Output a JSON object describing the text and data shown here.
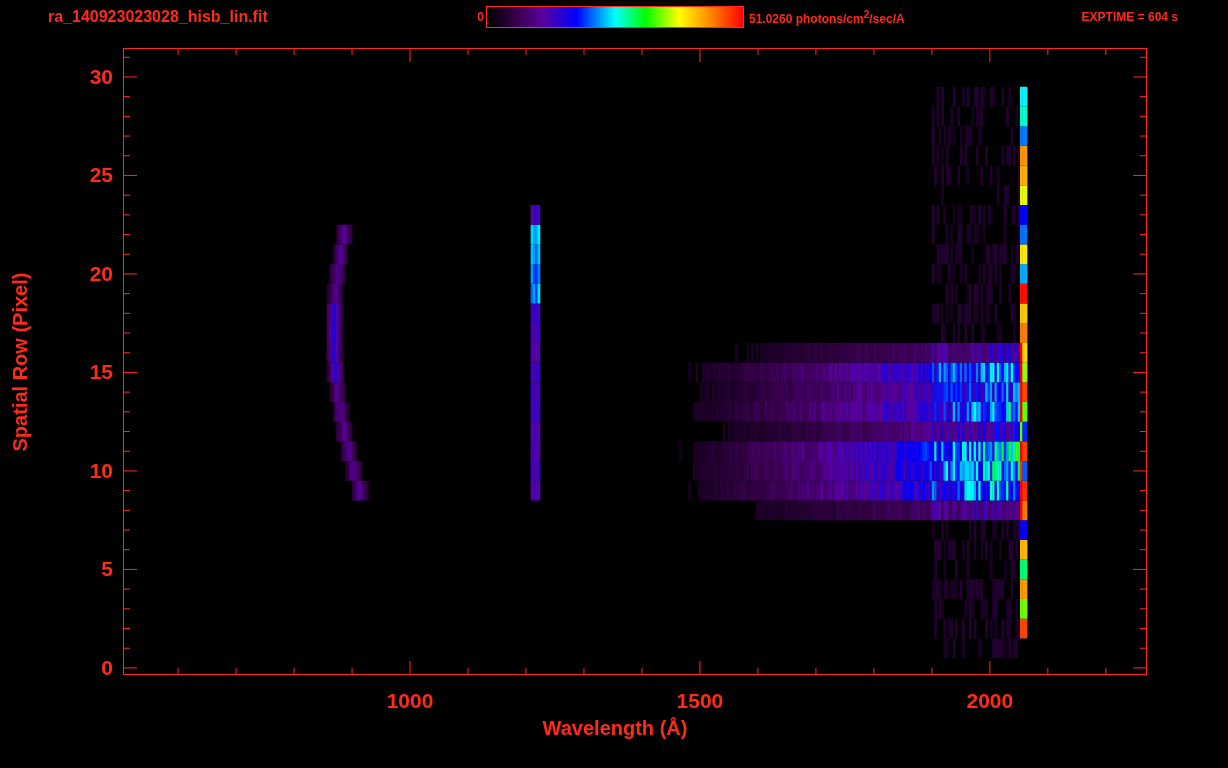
{
  "header": {
    "filename": "ra_140923023028_hisb_lin.fit",
    "colorbar": {
      "min_label": "0",
      "max_label": "51.0260 photons/cm$^{2}$/sec/A"
    },
    "exposure": "EXPTIME = 604 s"
  },
  "plot": {
    "ylabel": "Spatial Row (Pixel)",
    "xlabel": "Wavelength (Å)",
    "yticks": [
      "30",
      "25",
      "20",
      "15",
      "10",
      "5",
      "0"
    ],
    "xticks": [
      "1000",
      "1500",
      "2000"
    ]
  }
}
